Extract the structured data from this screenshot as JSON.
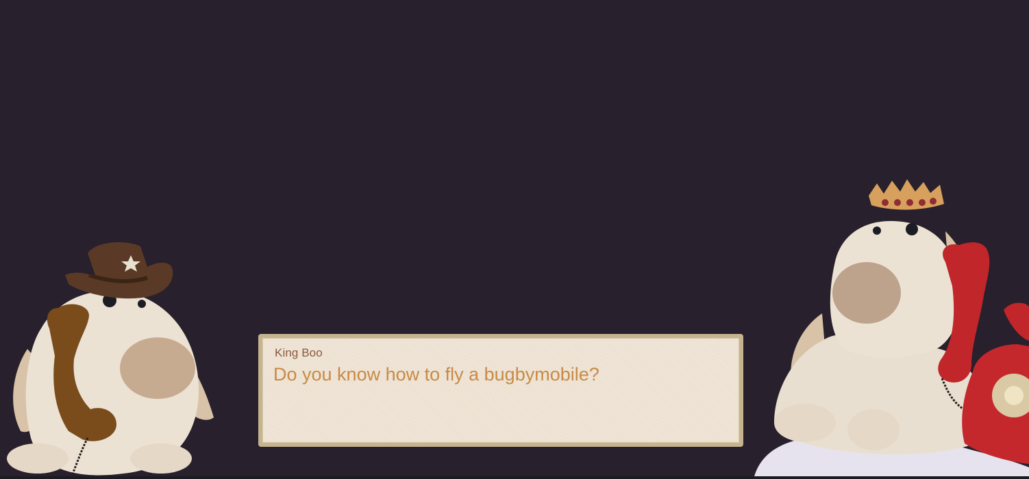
{
  "dialogue": {
    "speaker": "King Boo",
    "text": "Do you know how to fly a bugbymobile?"
  },
  "characters": {
    "left": {
      "icon": "cowboy-plush-with-brown-phone",
      "colors": {
        "body": "#efe6da",
        "spot": "#c2a589",
        "hat": "#5a3a26",
        "phone": "#7a4c1b"
      }
    },
    "right": {
      "icon": "king-plush-with-red-phone",
      "colors": {
        "body": "#efe6da",
        "spot": "#b89c84",
        "crown": "#d7a05c",
        "jewel": "#8f2c34",
        "phone": "#c0262a"
      }
    }
  },
  "theme": {
    "background": "#28202c",
    "panel": "#efe4d4",
    "panel_border": "#c5b48f",
    "speaker_color": "#8c5a3c",
    "text_color": "#c98a45"
  }
}
